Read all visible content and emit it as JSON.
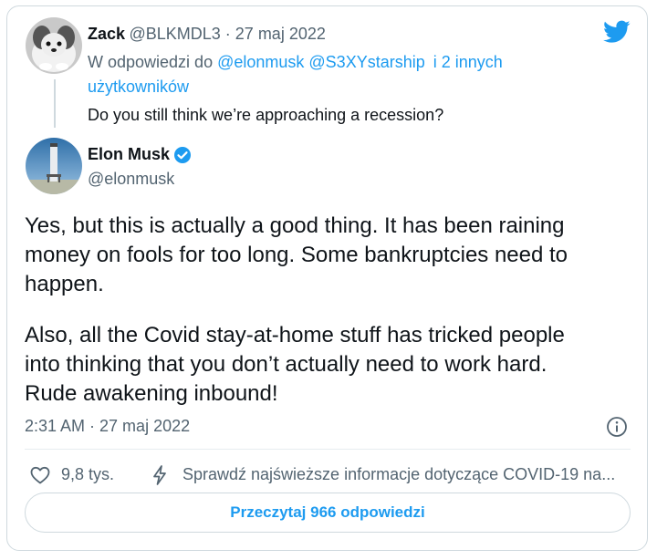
{
  "reply": {
    "name": "Zack",
    "handle_date": "@BLKMDL3 · 27 maj 2022",
    "reply_prefix": "W odpowiedzi do",
    "reply_users": "@elonmusk @S3XYstarship",
    "reply_others": "i 2 innych",
    "reply_line2": "użytkowników",
    "text": "Do you still think we’re approaching a recession?"
  },
  "tweet": {
    "name": "Elon Musk",
    "handle": "@elonmusk",
    "paragraph1": "Yes, but this is actually a good thing. It has been raining\nmoney on fools for too long. Some bankruptcies need to\nhappen.",
    "paragraph2": "Also, all the Covid stay-at-home stuff has tricked people\ninto thinking that you don’t actually need to work hard.\nRude awakening inbound!",
    "timestamp": "2:31 AM · 27 maj 2022"
  },
  "actions": {
    "likes": "9,8 tys.",
    "covid_notice": "Sprawdź najświeższe informacje dotyczące COVID-19 na...",
    "read_replies": "Przeczytaj 966 odpowiedzi"
  },
  "colors": {
    "accent": "#1d9bf0",
    "muted": "#536471",
    "text": "#0f1419",
    "border": "#cfd9de"
  },
  "icons": [
    "twitter-bird-icon",
    "verified-badge-icon",
    "info-icon",
    "heart-icon",
    "lightning-icon"
  ]
}
